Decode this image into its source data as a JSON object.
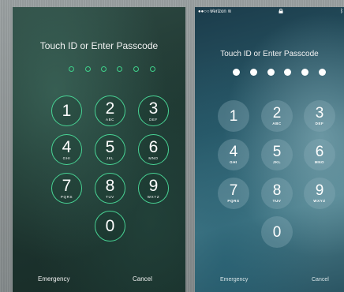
{
  "left_screen": {
    "title": "Touch ID or Enter Passcode",
    "dots": 6,
    "keys": [
      {
        "digit": "1",
        "letters": ""
      },
      {
        "digit": "2",
        "letters": "ABC"
      },
      {
        "digit": "3",
        "letters": "DEF"
      },
      {
        "digit": "4",
        "letters": "GHI"
      },
      {
        "digit": "5",
        "letters": "JKL"
      },
      {
        "digit": "6",
        "letters": "MNO"
      },
      {
        "digit": "7",
        "letters": "PQRS"
      },
      {
        "digit": "8",
        "letters": "TUV"
      },
      {
        "digit": "9",
        "letters": "WXYZ"
      },
      {
        "digit": "0",
        "letters": ""
      }
    ],
    "emergency_label": "Emergency",
    "cancel_label": "Cancel",
    "accent_color": "#48d394"
  },
  "right_screen": {
    "status": {
      "carrier": "Verizon"
    },
    "title": "Touch ID or Enter Passcode",
    "dots": 6,
    "keys": [
      {
        "digit": "1",
        "letters": ""
      },
      {
        "digit": "2",
        "letters": "ABC"
      },
      {
        "digit": "3",
        "letters": "DEF"
      },
      {
        "digit": "4",
        "letters": "GHI"
      },
      {
        "digit": "5",
        "letters": "JKL"
      },
      {
        "digit": "6",
        "letters": "MNO"
      },
      {
        "digit": "7",
        "letters": "PQRS"
      },
      {
        "digit": "8",
        "letters": "TUV"
      },
      {
        "digit": "9",
        "letters": "WXYZ"
      },
      {
        "digit": "0",
        "letters": ""
      }
    ],
    "emergency_label": "Emergency",
    "cancel_label": "Cancel"
  }
}
